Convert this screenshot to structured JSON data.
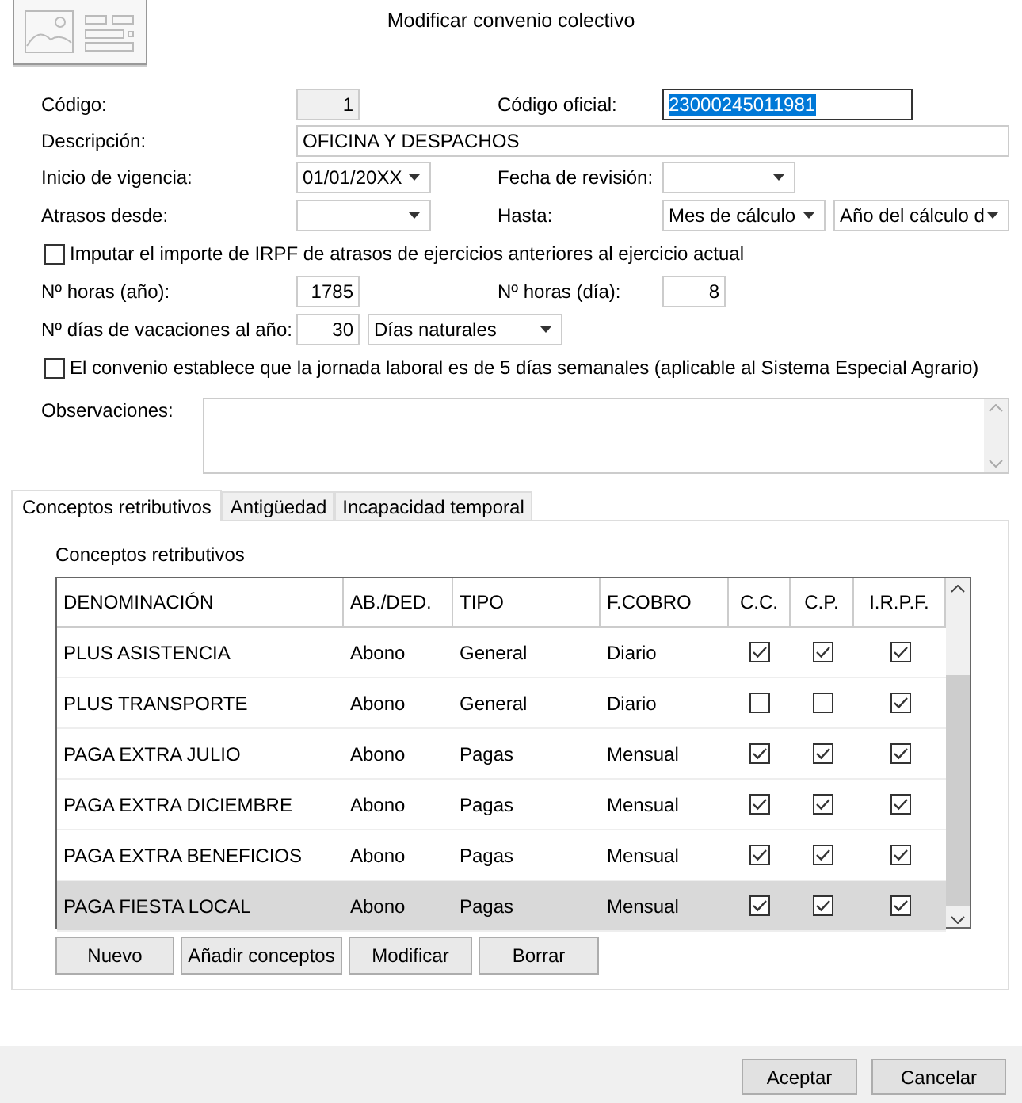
{
  "window": {
    "title": "Modificar convenio colectivo"
  },
  "form": {
    "rows": [
      {
        "kind": "fields",
        "items": [
          {
            "kind": "label",
            "text": "Código:"
          },
          {
            "kind": "readonly",
            "value": "1"
          },
          {
            "kind": "label",
            "text": "Código oficial:"
          },
          {
            "kind": "text",
            "value": "23000245011981",
            "focused": true,
            "text_selected": true
          }
        ]
      },
      {
        "kind": "fields",
        "items": [
          {
            "kind": "label",
            "text": "Descripción:"
          },
          {
            "kind": "text",
            "value": "OFICINA Y DESPACHOS"
          }
        ]
      },
      {
        "kind": "fields",
        "items": [
          {
            "kind": "label",
            "text": "Inicio de vigencia:"
          },
          {
            "kind": "combo",
            "value": "01/01/20XX"
          },
          {
            "kind": "label",
            "text": "Fecha de revisión:"
          },
          {
            "kind": "combo"
          }
        ]
      },
      {
        "kind": "fields",
        "items": [
          {
            "kind": "label",
            "text": "Atrasos desde:"
          },
          {
            "kind": "combo"
          },
          {
            "kind": "label",
            "text": "Hasta:"
          },
          {
            "kind": "combo",
            "value": "Mes de cálculo"
          },
          {
            "kind": "combo",
            "value": "Año del cálculo d"
          }
        ]
      },
      {
        "kind": "checkbox",
        "label": "Imputar el importe de IRPF de atrasos de ejercicios anteriores al ejercicio actual",
        "checked": false
      },
      {
        "kind": "fields",
        "items": [
          {
            "kind": "label",
            "text": "Nº horas (año):"
          },
          {
            "kind": "number",
            "value": "1785"
          },
          {
            "kind": "label",
            "text": "Nº horas (día):"
          },
          {
            "kind": "number",
            "value": "8"
          }
        ]
      },
      {
        "kind": "fields",
        "items": [
          {
            "kind": "label",
            "text": "Nº días de vacaciones al año:"
          },
          {
            "kind": "number",
            "value": "30"
          },
          {
            "kind": "combo",
            "value": "Días naturales"
          }
        ]
      },
      {
        "kind": "checkbox",
        "label": "El convenio establece que la jornada laboral es de 5 días semanales (aplicable al Sistema Especial Agrario)",
        "checked": false
      }
    ],
    "observations": {
      "label": "Observaciones:"
    }
  },
  "tabs": [
    {
      "label": "Conceptos retributivos",
      "selected": true
    },
    {
      "label": "Antigüedad",
      "selected": false
    },
    {
      "label": "Incapacidad temporal",
      "selected": false
    }
  ],
  "panel": {
    "title": "Conceptos retributivos",
    "table": {
      "columns": [
        "DENOMINACIÓN",
        "AB./DED.",
        "TIPO",
        "F.COBRO",
        "C.C.",
        "C.P.",
        "I.R.P.F."
      ],
      "rows": [
        {
          "cells": [
            "PLUS ASISTENCIA",
            "Abono",
            "General",
            "Diario"
          ],
          "checks": [
            true,
            true,
            true
          ],
          "selected": false
        },
        {
          "cells": [
            "PLUS TRANSPORTE",
            "Abono",
            "General",
            "Diario"
          ],
          "checks": [
            false,
            false,
            true
          ],
          "selected": false
        },
        {
          "cells": [
            "PAGA EXTRA JULIO",
            "Abono",
            "Pagas",
            "Mensual"
          ],
          "checks": [
            true,
            true,
            true
          ],
          "selected": false
        },
        {
          "cells": [
            "PAGA EXTRA DICIEMBRE",
            "Abono",
            "Pagas",
            "Mensual"
          ],
          "checks": [
            true,
            true,
            true
          ],
          "selected": false
        },
        {
          "cells": [
            "PAGA EXTRA BENEFICIOS",
            "Abono",
            "Pagas",
            "Mensual"
          ],
          "checks": [
            true,
            true,
            true
          ],
          "selected": false
        },
        {
          "cells": [
            "PAGA FIESTA LOCAL",
            "Abono",
            "Pagas",
            "Mensual"
          ],
          "checks": [
            true,
            true,
            true
          ],
          "selected": true
        }
      ]
    },
    "buttons": [
      "Nuevo",
      "Añadir conceptos",
      "Modificar",
      "Borrar"
    ]
  },
  "footer": {
    "buttons": [
      "Aceptar",
      "Cancelar"
    ]
  }
}
